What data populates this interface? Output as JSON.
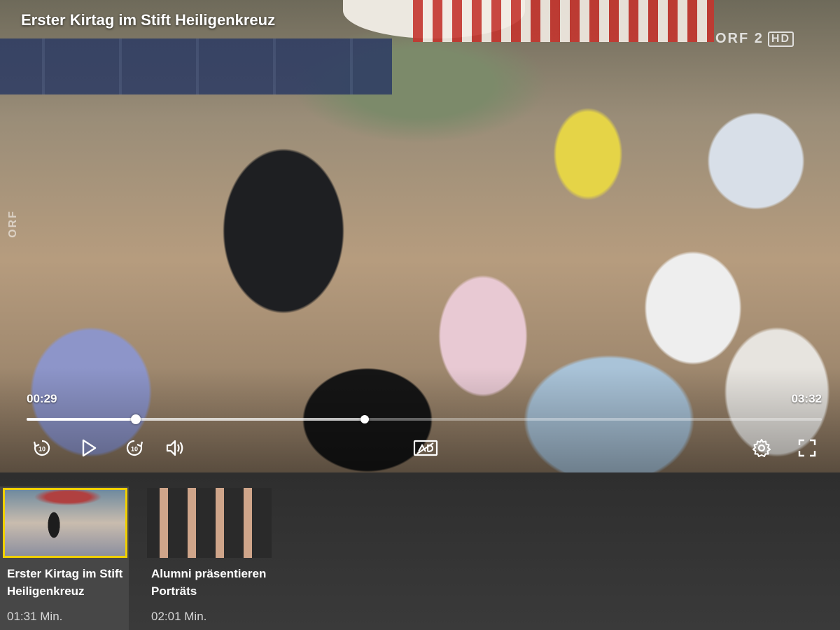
{
  "player": {
    "title": "Erster Kirtag im Stift Heiligenkreuz",
    "channel_logo": "ORF 2",
    "channel_hd": "HD",
    "watermark": "ORF",
    "current_time": "00:29",
    "total_time": "03:32",
    "progress_fraction": 0.137,
    "hover_fraction": 0.425,
    "controls": {
      "rewind_icon": "rewind-10-icon",
      "play_icon": "play-icon",
      "forward_icon": "forward-10-icon",
      "volume_icon": "volume-icon",
      "audio_description_icon": "audio-description-icon",
      "settings_icon": "gear-icon",
      "fullscreen_icon": "fullscreen-icon"
    }
  },
  "playlist": {
    "items": [
      {
        "title": "Erster Kirtag im Stift Heiligenkreuz",
        "duration": "01:31 Min.",
        "active": true
      },
      {
        "title": "Alumni präsentieren Porträts",
        "duration": "02:01 Min.",
        "active": false
      }
    ]
  },
  "colors": {
    "active_border": "#f0d000",
    "playlist_bg": "#2e2e2e",
    "active_card_bg": "#474747"
  }
}
